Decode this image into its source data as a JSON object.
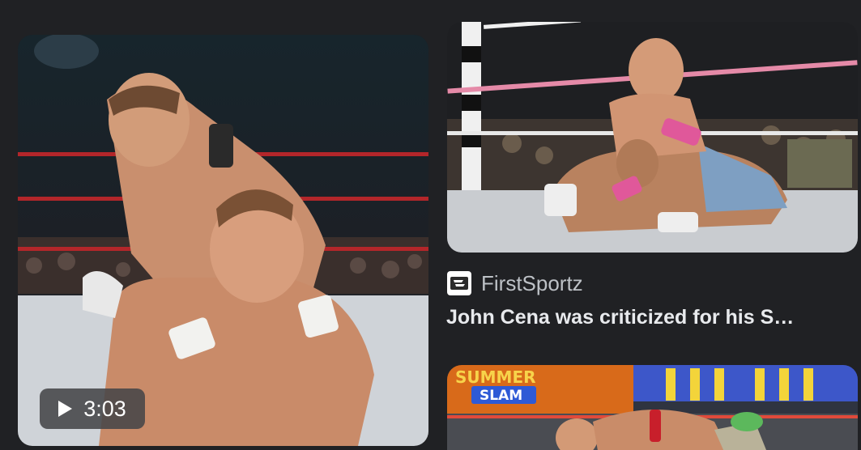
{
  "video_result": {
    "duration": "3:03",
    "image_alt": "Wrestler applying a chokehold to another wrestler in the ring",
    "play_icon": "play-icon"
  },
  "article_result": {
    "image_alt": "John Cena applying a submission hold in the ring",
    "source_icon": "firstsportz-logo-icon",
    "source_name": "FirstSportz",
    "headline": "John Cena was criticized for his S…"
  },
  "next_result": {
    "image_alt": "SummerSlam match with a wrestler on the mat",
    "banner_text_top": "SUMMER",
    "banner_text_bottom": "SLAM"
  },
  "colors": {
    "background": "#202124",
    "source_text": "#bdc1c6",
    "headline_text": "#e8eaed"
  }
}
